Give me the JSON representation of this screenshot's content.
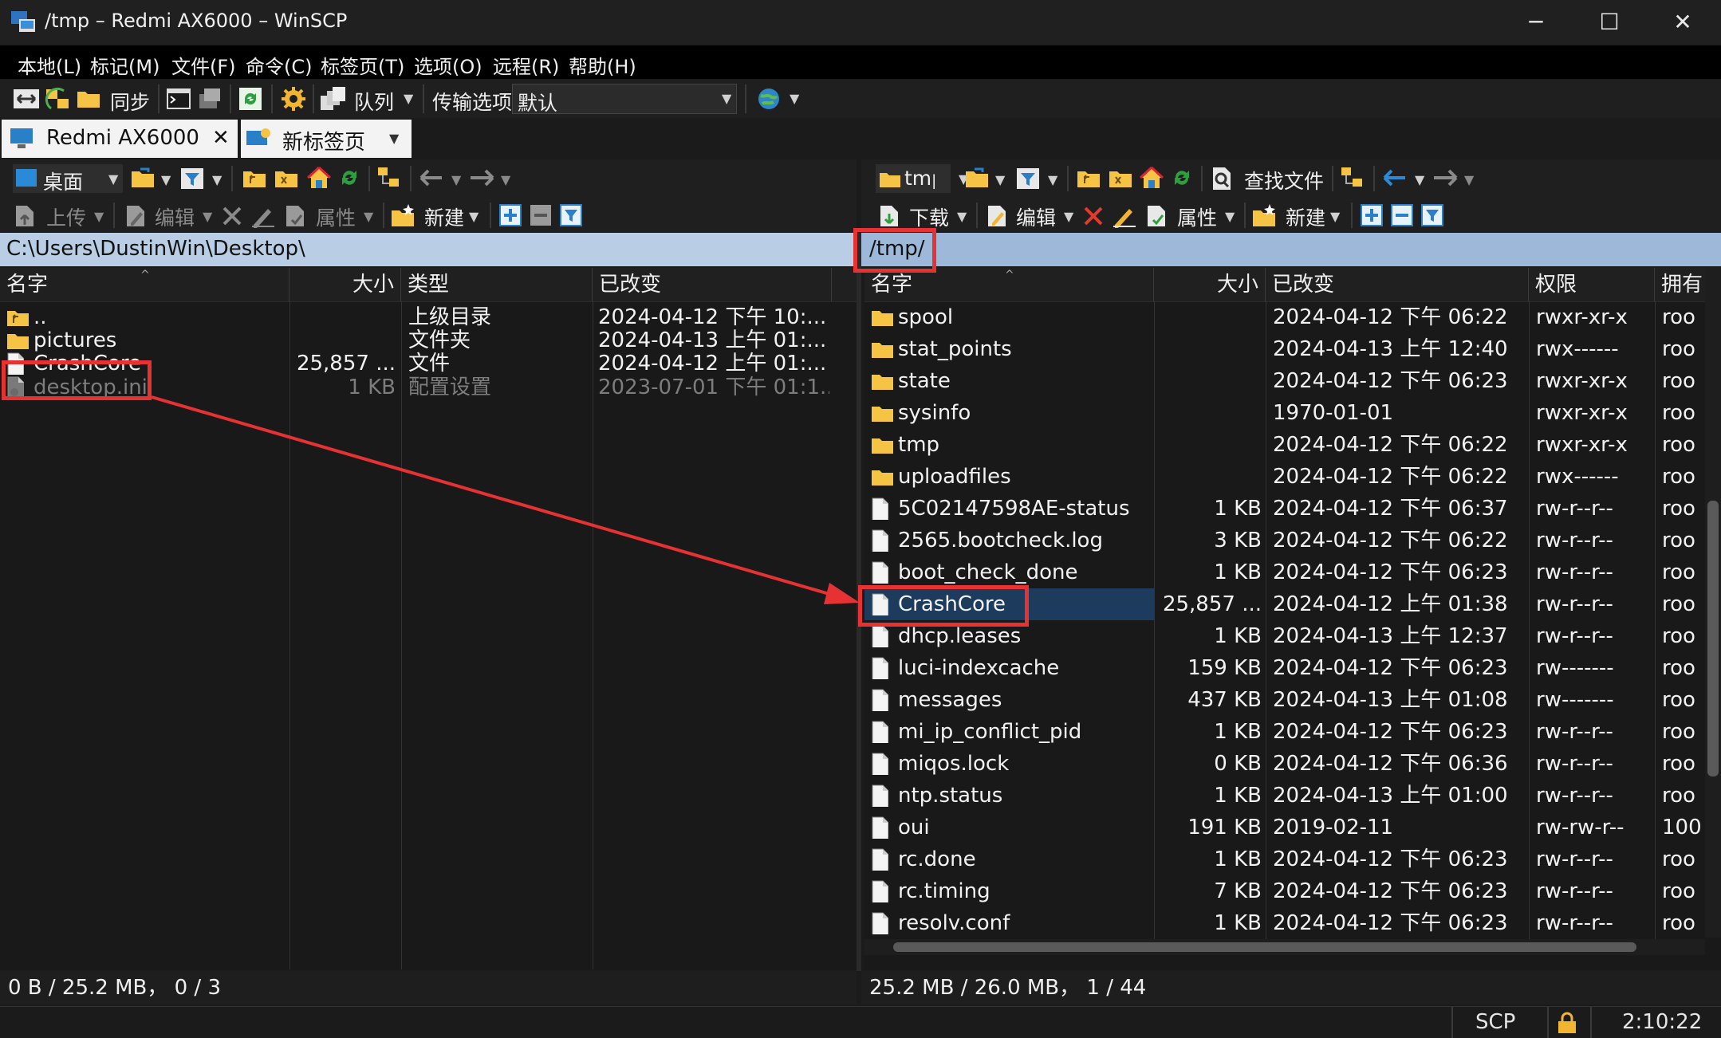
{
  "window": {
    "title": "/tmp – Redmi AX6000 – WinSCP",
    "minimize": "─",
    "maximize": "☐",
    "close": "✕"
  },
  "menu": [
    "本地(L)",
    "标记(M)",
    "文件(F)",
    "命令(C)",
    "标签页(T)",
    "选项(O)",
    "远程(R)",
    "帮助(H)"
  ],
  "toolbar": {
    "sync_label": "同步",
    "queue_label": "队列",
    "transfer_options_label": "传输选项",
    "transfer_preset": "默认"
  },
  "tabs": [
    {
      "label": "Redmi AX6000",
      "close": "✕"
    },
    {
      "label": "新标签页"
    }
  ],
  "left": {
    "location": "桌面",
    "actions": {
      "upload": "上传",
      "edit": "编辑",
      "properties": "属性",
      "new": "新建"
    },
    "path": "C:\\Users\\DustinWin\\Desktop\\",
    "columns": [
      "名字",
      "大小",
      "类型",
      "已改变"
    ],
    "files": [
      {
        "name": "..",
        "size": "",
        "type": "上级目录",
        "changed": "2024-04-12 下午 10:...",
        "icon": "parent-folder",
        "dim": false
      },
      {
        "name": "pictures",
        "size": "",
        "type": "文件夹",
        "changed": "2024-04-13 上午 01:...",
        "icon": "folder",
        "dim": false
      },
      {
        "name": "CrashCore",
        "size": "25,857 ...",
        "type": "文件",
        "changed": "2024-04-12 上午 01:...",
        "icon": "file",
        "dim": false
      },
      {
        "name": "desktop.ini",
        "size": "1 KB",
        "type": "配置设置",
        "changed": "2023-07-01 下午 01:1...",
        "icon": "settings-file",
        "dim": true
      }
    ],
    "status": "0 B / 25.2 MB，  0 / 3"
  },
  "right": {
    "location": "tmp",
    "actions": {
      "download": "下载",
      "edit": "编辑",
      "properties": "属性",
      "new": "新建",
      "find": "查找文件"
    },
    "path": "/tmp/",
    "columns": [
      "名字",
      "大小",
      "已改变",
      "权限",
      "拥有"
    ],
    "files": [
      {
        "name": "spool",
        "size": "",
        "changed": "2024-04-12 下午 06:22",
        "perm": "rwxr-xr-x",
        "owner": "roo",
        "icon": "folder"
      },
      {
        "name": "stat_points",
        "size": "",
        "changed": "2024-04-13 上午 12:40",
        "perm": "rwx------",
        "owner": "roo",
        "icon": "folder"
      },
      {
        "name": "state",
        "size": "",
        "changed": "2024-04-12 下午 06:23",
        "perm": "rwxr-xr-x",
        "owner": "roo",
        "icon": "folder"
      },
      {
        "name": "sysinfo",
        "size": "",
        "changed": "1970-01-01",
        "perm": "rwxr-xr-x",
        "owner": "roo",
        "icon": "folder"
      },
      {
        "name": "tmp",
        "size": "",
        "changed": "2024-04-12 下午 06:22",
        "perm": "rwxr-xr-x",
        "owner": "roo",
        "icon": "folder"
      },
      {
        "name": "uploadfiles",
        "size": "",
        "changed": "2024-04-12 下午 06:22",
        "perm": "rwx------",
        "owner": "roo",
        "icon": "folder"
      },
      {
        "name": "5C02147598AE-status",
        "size": "1 KB",
        "changed": "2024-04-12 下午 06:37",
        "perm": "rw-r--r--",
        "owner": "roo",
        "icon": "file"
      },
      {
        "name": "2565.bootcheck.log",
        "size": "3 KB",
        "changed": "2024-04-12 下午 06:22",
        "perm": "rw-r--r--",
        "owner": "roo",
        "icon": "file"
      },
      {
        "name": "boot_check_done",
        "size": "1 KB",
        "changed": "2024-04-12 下午 06:23",
        "perm": "rw-r--r--",
        "owner": "roo",
        "icon": "file"
      },
      {
        "name": "CrashCore",
        "size": "25,857 ...",
        "changed": "2024-04-12 上午 01:38",
        "perm": "rw-r--r--",
        "owner": "roo",
        "icon": "file",
        "selected": true
      },
      {
        "name": "dhcp.leases",
        "size": "1 KB",
        "changed": "2024-04-13 上午 12:37",
        "perm": "rw-r--r--",
        "owner": "roo",
        "icon": "file"
      },
      {
        "name": "luci-indexcache",
        "size": "159 KB",
        "changed": "2024-04-12 下午 06:23",
        "perm": "rw-------",
        "owner": "roo",
        "icon": "file"
      },
      {
        "name": "messages",
        "size": "437 KB",
        "changed": "2024-04-13 上午 01:08",
        "perm": "rw-------",
        "owner": "roo",
        "icon": "file"
      },
      {
        "name": "mi_ip_conflict_pid",
        "size": "1 KB",
        "changed": "2024-04-12 下午 06:23",
        "perm": "rw-r--r--",
        "owner": "roo",
        "icon": "file"
      },
      {
        "name": "miqos.lock",
        "size": "0 KB",
        "changed": "2024-04-12 下午 06:36",
        "perm": "rw-r--r--",
        "owner": "roo",
        "icon": "file"
      },
      {
        "name": "ntp.status",
        "size": "1 KB",
        "changed": "2024-04-13 上午 01:00",
        "perm": "rw-r--r--",
        "owner": "roo",
        "icon": "file"
      },
      {
        "name": "oui",
        "size": "191 KB",
        "changed": "2019-02-11",
        "perm": "rw-rw-r--",
        "owner": "100",
        "icon": "file"
      },
      {
        "name": "rc.done",
        "size": "1 KB",
        "changed": "2024-04-12 下午 06:23",
        "perm": "rw-r--r--",
        "owner": "roo",
        "icon": "file"
      },
      {
        "name": "rc.timing",
        "size": "7 KB",
        "changed": "2024-04-12 下午 06:23",
        "perm": "rw-r--r--",
        "owner": "roo",
        "icon": "file"
      },
      {
        "name": "resolv.conf",
        "size": "1 KB",
        "changed": "2024-04-12 下午 06:23",
        "perm": "rw-r--r--",
        "owner": "roo",
        "icon": "file"
      }
    ],
    "status": "25.2 MB / 26.0 MB，  1 / 44"
  },
  "statusbar": {
    "protocol": "SCP",
    "elapsed": "2:10:22"
  },
  "colors": {
    "highlight": "#e63232",
    "path_bar": "#b9cde4",
    "folder": "#f6c445",
    "selection": "#1d3b5c"
  }
}
